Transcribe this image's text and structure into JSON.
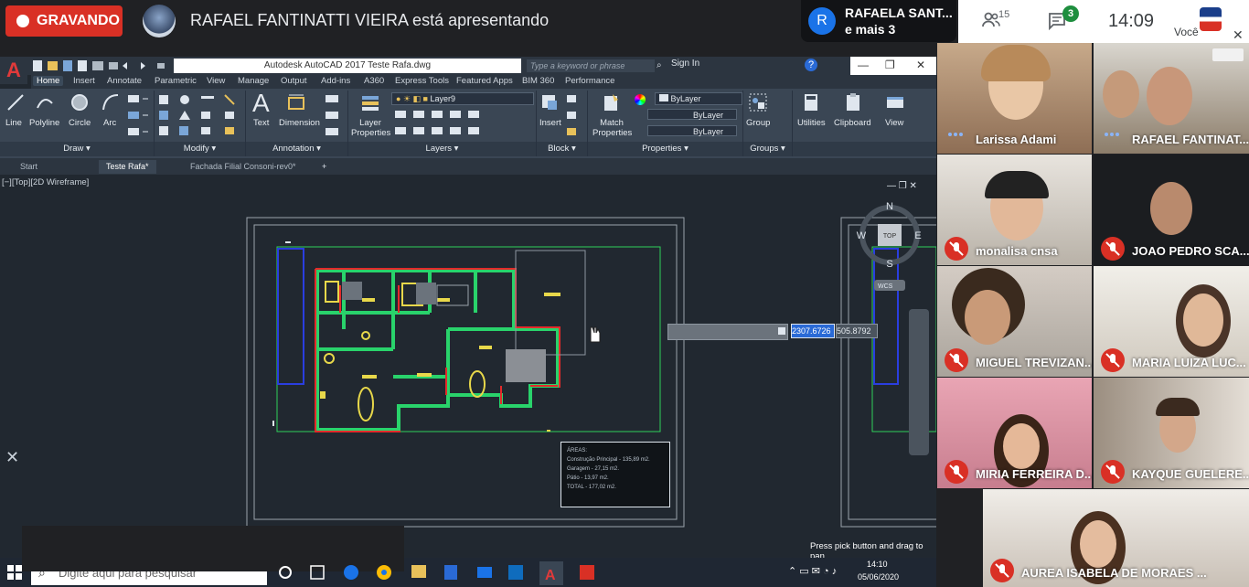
{
  "meet": {
    "recording_label": "GRAVANDO",
    "presenter_text": "RAFAEL FANTINATTI VIEIRA está apresentando",
    "pinned_initial": "R",
    "pinned_name": "RAFAELA SANT...",
    "pinned_more": "e mais 3",
    "people_count": "15",
    "chat_badge": "3",
    "clock": "14:09",
    "you_label": "Você"
  },
  "autocad": {
    "title": "Autodesk AutoCAD 2017    Teste Rafa.dwg",
    "search_placeholder": "Type a keyword or phrase",
    "sign_in": "Sign In",
    "menu_tabs": [
      "Home",
      "Insert",
      "Annotate",
      "Parametric",
      "View",
      "Manage",
      "Output",
      "Add-ins",
      "A360",
      "Express Tools",
      "Featured Apps",
      "BIM 360",
      "Performance"
    ],
    "draw_tools": [
      "Line",
      "Polyline",
      "Circle",
      "Arc"
    ],
    "annotation_tools": [
      "Text",
      "Dimension"
    ],
    "layer_tools": [
      "Layer Properties"
    ],
    "block_tools": [
      "Insert"
    ],
    "properties_tools": [
      "Match Properties"
    ],
    "other_tools": [
      "Group",
      "Utilities",
      "Clipboard",
      "View"
    ],
    "panels": [
      "Draw",
      "Modify",
      "Annotation",
      "Layers",
      "Block",
      "Properties",
      "Groups"
    ],
    "layer_name": "Layer9",
    "bylayer_1": "ByLayer",
    "bylayer_2": "ByLayer",
    "bylayer_3": "ByLayer",
    "file_tabs": [
      "Start",
      "Teste Rafa*",
      "Fachada Filial Consoni-rev0*"
    ],
    "viewport_label": "[−][Top][2D Wireframe]",
    "coord_x": "2307.6726",
    "coord_y": "505.8792",
    "command_msg": "Press pick button and drag to pan.",
    "viewcube": {
      "n": "N",
      "s": "S",
      "e": "E",
      "w": "W",
      "top": "TOP",
      "wcs": "WCS"
    },
    "areas_lines": [
      "ÁREAS:",
      "Construção Principal - 135,89 m2.",
      "Garagem - 27,15 m2.",
      "Pátio - 13,97 m2.",
      "TOTAL - 177,02 m2."
    ]
  },
  "taskbar": {
    "search_placeholder": "Digite aqui para pesquisar",
    "time": "14:10",
    "date": "05/06/2020"
  },
  "participants": [
    {
      "name": "Larissa Adami",
      "mic": "speaking"
    },
    {
      "name": "RAFAEL FANTINAT...",
      "mic": "speaking"
    },
    {
      "name": "monalisa cnsa",
      "mic": "muted"
    },
    {
      "name": "JOAO PEDRO SCA...",
      "mic": "muted"
    },
    {
      "name": "MIGUEL TREVIZAN...",
      "mic": "muted"
    },
    {
      "name": "MARIA LUIZA LUC...",
      "mic": "muted"
    },
    {
      "name": "MIRIA FERREIRA D...",
      "mic": "muted"
    },
    {
      "name": "KAYQUE GUELERE...",
      "mic": "muted"
    },
    {
      "name": "AUREA ISABELA DE MORAES ...",
      "mic": "muted"
    }
  ]
}
